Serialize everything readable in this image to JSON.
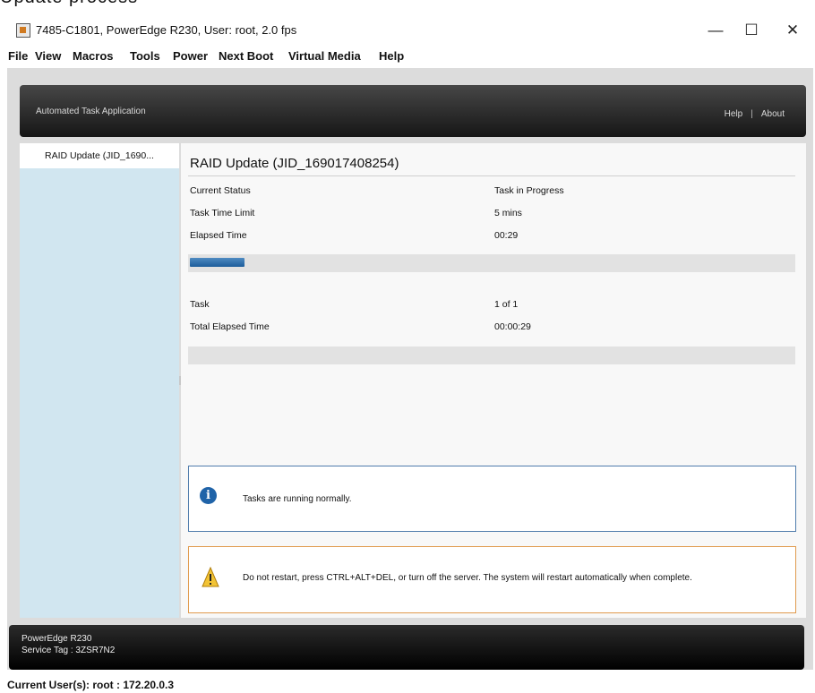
{
  "page_heading_partial": "Update process",
  "window": {
    "title": "7485-C1801, PowerEdge R230, User: root, 2.0 fps",
    "app_icon": "java-icon",
    "controls": {
      "minimize": "—",
      "maximize": "☐",
      "close": "✕"
    }
  },
  "menu": [
    "File",
    "View",
    "Macros",
    "Tools",
    "Power",
    "Next Boot",
    "Virtual Media",
    "Help"
  ],
  "header": {
    "title": "Automated Task Application",
    "help": "Help",
    "separator": "|",
    "about": "About"
  },
  "sidebar": {
    "items": [
      {
        "label": "RAID Update (JID_1690..."
      }
    ]
  },
  "task": {
    "title": "RAID Update (JID_169017408254)",
    "rows": [
      {
        "label": "Current Status",
        "value": "Task in Progress"
      },
      {
        "label": "Task Time Limit",
        "value": "5 mins"
      },
      {
        "label": "Elapsed Time",
        "value": "00:29"
      }
    ],
    "progress_fraction": 0.09,
    "summary_rows": [
      {
        "label": "Task",
        "value": "1 of 1"
      },
      {
        "label": "Total Elapsed Time",
        "value": "00:00:29"
      }
    ],
    "total_progress_fraction": 0
  },
  "messages": {
    "info": {
      "icon": "info-icon",
      "text": "Tasks are running normally."
    },
    "warning": {
      "icon": "warning-icon",
      "text": "Do not restart, press CTRL+ALT+DEL, or turn off the server.  The system will restart automatically when complete."
    }
  },
  "footer": {
    "model": "PowerEdge R230",
    "service_tag": "Service Tag : 3ZSR7N2"
  },
  "status_bar": {
    "text": "Current User(s): root : 172.20.0.3"
  },
  "colors": {
    "accent_blue": "#1f63a8",
    "sidebar_bg": "#d1e6f0",
    "warning_border": "#e09a4d"
  }
}
